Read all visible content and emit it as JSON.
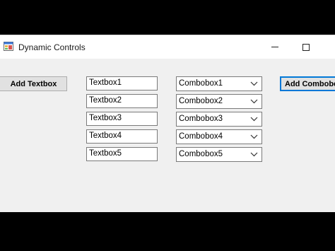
{
  "window": {
    "title": "Dynamic Controls",
    "minimize_icon": "minimize-icon",
    "maximize_icon": "maximize-icon"
  },
  "buttons": {
    "add_textbox": "Add Textbox",
    "add_combobox": "Add Combobox"
  },
  "textboxes": [
    "Textbox1",
    "Textbox2",
    "Textbox3",
    "Textbox4",
    "Textbox5"
  ],
  "comboboxes": [
    "Combobox1",
    "Combobox2",
    "Combobox3",
    "Combobox4",
    "Combobox5"
  ],
  "colors": {
    "focus_border": "#0078d7",
    "form_background": "#f0f0f0"
  }
}
